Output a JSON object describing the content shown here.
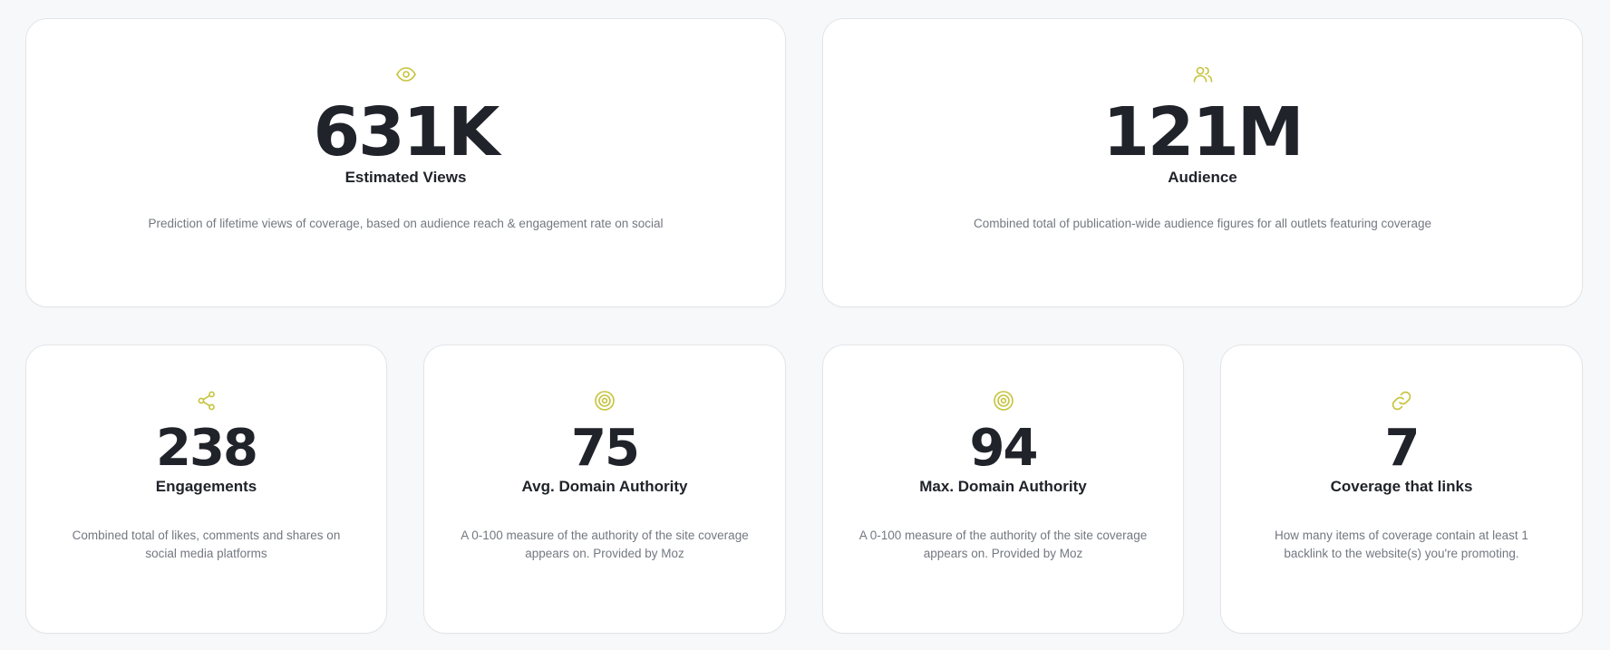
{
  "theme": {
    "accent": "#c6c33c",
    "text": "#20232a",
    "muted": "#737880",
    "background": "#f7f8fa",
    "card_border": "#e3e5e8"
  },
  "metrics": [
    {
      "icon": "eye-icon",
      "value": "631K",
      "label": "Estimated Views",
      "description": "Prediction of lifetime views of coverage, based on audience reach & engagement rate on social"
    },
    {
      "icon": "users-icon",
      "value": "121M",
      "label": "Audience",
      "description": "Combined total of publication-wide audience figures for all outlets featuring coverage"
    },
    {
      "icon": "share-icon",
      "value": "238",
      "label": "Engagements",
      "description": "Combined total of likes, comments and shares on social media platforms"
    },
    {
      "icon": "target-icon",
      "value": "75",
      "label": "Avg. Domain Authority",
      "description": "A 0-100 measure of the authority of the site coverage appears on. Provided by Moz"
    },
    {
      "icon": "target-icon",
      "value": "94",
      "label": "Max. Domain Authority",
      "description": "A 0-100 measure of the authority of the site coverage appears on. Provided by Moz"
    },
    {
      "icon": "link-icon",
      "value": "7",
      "label": "Coverage that links",
      "description": "How many items of coverage contain at least 1 backlink to the website(s) you're promoting."
    }
  ]
}
